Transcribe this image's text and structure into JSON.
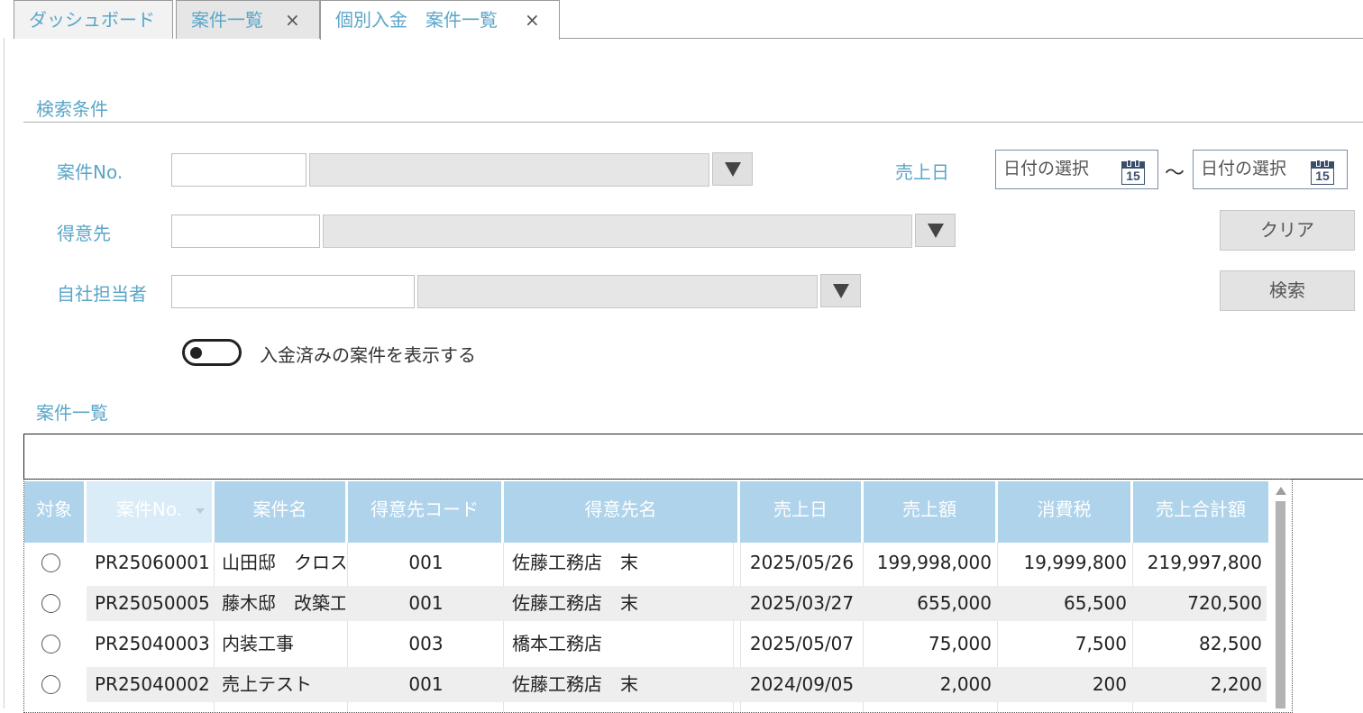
{
  "tabs": [
    {
      "label": "ダッシュボード"
    },
    {
      "label": "案件一覧",
      "close": "×"
    },
    {
      "label": "個別入金　案件一覧",
      "close": "×"
    }
  ],
  "search": {
    "title": "検索条件",
    "case_no_label": "案件No.",
    "customer_label": "得意先",
    "staff_label": "自社担当者",
    "sales_date_label": "売上日",
    "date_from_placeholder": "日付の選択",
    "date_to_placeholder": "日付の選択",
    "calendar_day": "15",
    "tilde": "～",
    "clear_button": "クリア",
    "search_button": "検索",
    "toggle_label": "入金済みの案件を表示する",
    "toggle_on": false
  },
  "list": {
    "title": "案件一覧",
    "columns": [
      "対象",
      "案件No.",
      "案件名",
      "得意先コード",
      "得意先名",
      "売上日",
      "売上額",
      "消費税",
      "売上合計額"
    ],
    "rows": [
      {
        "case_no": "PR25060001",
        "name": "山田邸　クロス",
        "code": "001",
        "customer": "佐藤工務店　末",
        "date": "2025/05/26",
        "amount": "199,998,000",
        "tax": "19,999,800",
        "total": "219,997,800"
      },
      {
        "case_no": "PR25050005",
        "name": "藤木邸　改築工",
        "code": "001",
        "customer": "佐藤工務店　末",
        "date": "2025/03/27",
        "amount": "655,000",
        "tax": "65,500",
        "total": "720,500"
      },
      {
        "case_no": "PR25040003",
        "name": "内装工事",
        "code": "003",
        "customer": "橋本工務店",
        "date": "2025/05/07",
        "amount": "75,000",
        "tax": "7,500",
        "total": "82,500"
      },
      {
        "case_no": "PR25040002",
        "name": "売上テスト",
        "code": "001",
        "customer": "佐藤工務店　末",
        "date": "2024/09/05",
        "amount": "2,000",
        "tax": "200",
        "total": "2,200"
      }
    ]
  }
}
